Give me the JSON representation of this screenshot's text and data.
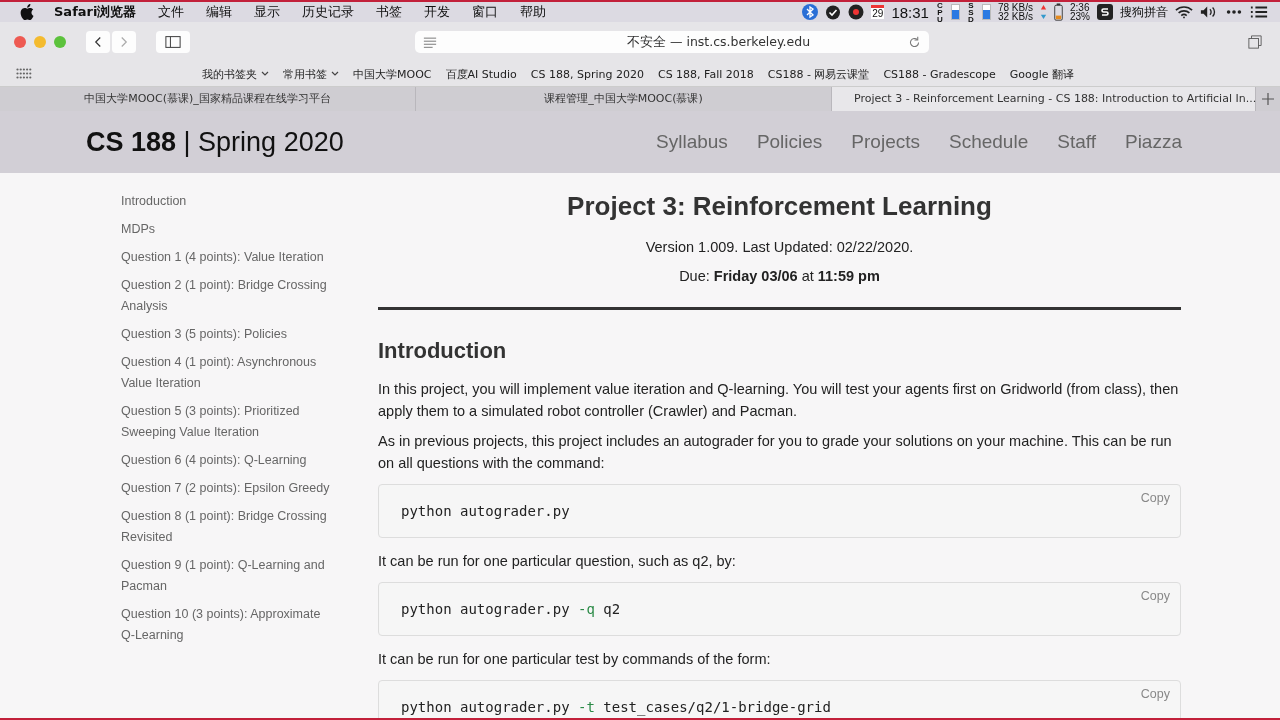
{
  "menu_bar": {
    "app": "Safari浏览器",
    "menus": [
      "文件",
      "编辑",
      "显示",
      "历史记录",
      "书签",
      "开发",
      "窗口",
      "帮助"
    ],
    "status": {
      "calendar_day": "29",
      "time": "18:31",
      "cpu_label": "CPU",
      "ssd_label": "SSD",
      "upload": "78 KB/s",
      "download": "32 KB/s",
      "battery_time": "2:36",
      "battery_percent": "23%",
      "input_method": "搜狗拼音"
    }
  },
  "address_bar": {
    "value": "不安全 — inst.cs.berkeley.edu"
  },
  "bookmarks": [
    {
      "label": "我的书签夹",
      "folder": true
    },
    {
      "label": "常用书签",
      "folder": true
    },
    {
      "label": "中国大学MOOC",
      "folder": false
    },
    {
      "label": "百度AI Studio",
      "folder": false
    },
    {
      "label": "CS 188, Spring 2020",
      "folder": false
    },
    {
      "label": "CS 188, Fall 2018",
      "folder": false
    },
    {
      "label": "CS188 - 网易云课堂",
      "folder": false
    },
    {
      "label": "CS188 - Gradescope",
      "folder": false
    },
    {
      "label": "Google 翻译",
      "folder": false
    }
  ],
  "tabs": [
    {
      "label": "中国大学MOOC(慕课)_国家精品课程在线学习平台",
      "selected": false
    },
    {
      "label": "课程管理_中国大学MOOC(慕课)",
      "selected": false
    },
    {
      "label": "Project 3 - Reinforcement Learning - CS 188: Introduction to Artificial In...",
      "selected": true
    }
  ],
  "site": {
    "title_bold": "CS 188",
    "title_rest": "| Spring 2020",
    "nav": [
      "Syllabus",
      "Policies",
      "Projects",
      "Schedule",
      "Staff",
      "Piazza"
    ]
  },
  "sidebar": {
    "items": [
      "Introduction",
      "MDPs",
      "Question 1 (4 points): Value Iteration",
      "Question 2 (1 point): Bridge Crossing Analysis",
      "Question 3 (5 points): Policies",
      "Question 4 (1 point): Asynchronous Value Iteration",
      "Question 5 (3 points): Prioritized Sweeping Value Iteration",
      "Question 6 (4 points): Q-Learning",
      "Question 7 (2 points): Epsilon Greedy",
      "Question 8 (1 point): Bridge Crossing Revisited",
      "Question 9 (1 point): Q-Learning and Pacman",
      "Question 10 (3 points): Approximate Q-Learning"
    ]
  },
  "article": {
    "title": "Project 3: Reinforcement Learning",
    "version": "Version 1.009. Last Updated: 02/22/2020.",
    "due": "Due: **Friday 03/06** at **11:59 pm**",
    "section": "Introduction",
    "blocks": [
      {
        "kind": "text",
        "text": "In this project, you will implement value iteration and Q-learning. You will test your agents first on Gridworld (from class), then apply them to a simulated robot controller (Crawler) and Pacman."
      },
      {
        "kind": "text",
        "text": "As in previous projects, this project includes an autograder for you to grade your solutions on your machine. This can be run on all questions with the command:"
      },
      {
        "kind": "code",
        "copy": "Copy",
        "parts": [
          {
            "text": "python autograder.py",
            "flag": false
          }
        ]
      },
      {
        "kind": "text",
        "text": "It can be run for one particular question, such as q2, by:"
      },
      {
        "kind": "code",
        "copy": "Copy",
        "parts": [
          {
            "text": "python autograder.py ",
            "flag": false
          },
          {
            "text": "-q",
            "flag": true
          },
          {
            "text": " q2",
            "flag": false
          }
        ]
      },
      {
        "kind": "text",
        "text": "It can be run for one particular test by commands of the form:"
      },
      {
        "kind": "code",
        "copy": "Copy",
        "parts": [
          {
            "text": "python autograder.py ",
            "flag": false
          },
          {
            "text": "-t",
            "flag": true
          },
          {
            "text": " test_cases/q2/1-bridge-grid",
            "flag": false
          }
        ]
      }
    ]
  }
}
